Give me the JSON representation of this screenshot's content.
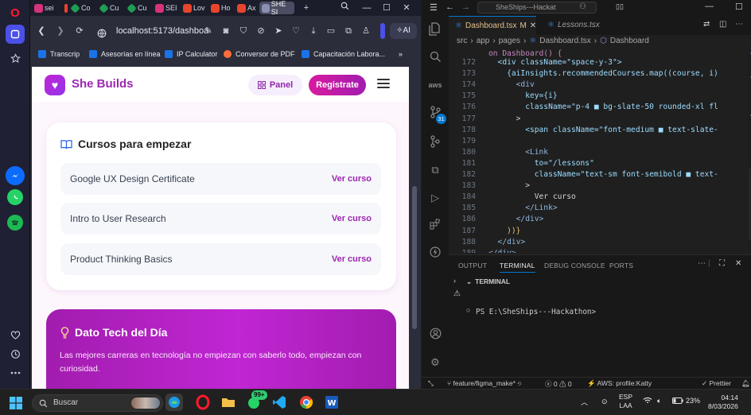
{
  "opera_sidebar": {
    "icons": [
      "opera-logo-icon",
      "workspace-icon",
      "star-icon",
      "messenger-icon",
      "whatsapp-icon",
      "spotify-icon",
      "heart-icon",
      "history-icon",
      "more-icon"
    ]
  },
  "browser": {
    "tabs": [
      {
        "label": "sei",
        "color": "#d6337d"
      },
      {
        "label": "",
        "color": "#e8452c"
      },
      {
        "label": "Co",
        "color": "#1f9d55"
      },
      {
        "label": "Cu",
        "color": "#1f9d55"
      },
      {
        "label": "Cu",
        "color": "#1f9d55"
      },
      {
        "label": "SEI",
        "color": "#d6337d"
      },
      {
        "label": "Lov",
        "color": "#e8452c"
      },
      {
        "label": "Ho",
        "color": "#e8452c"
      },
      {
        "label": "Ax",
        "color": "#e8452c"
      },
      {
        "label": "SHE SI",
        "color": "#8b8fb0"
      }
    ],
    "new_tab": "+",
    "url": "localhost:5173/dashboa",
    "ai_label": "AI",
    "bookmarks": [
      {
        "label": "Transcrip",
        "color": "#1a73e8"
      },
      {
        "label": "Asesorías en línea",
        "color": "#1a73e8"
      },
      {
        "label": "IP Calculator",
        "color": "#1a73e8"
      },
      {
        "label": "Conversor de PDF",
        "color": "#ff6d3a"
      },
      {
        "label": "Capacitación Labora...",
        "color": "#1a73e8"
      }
    ],
    "bookmarks_more": "»"
  },
  "page": {
    "brand": "She Builds",
    "panel_label": "Panel",
    "register_label": "Registrate",
    "courses": {
      "title": "Cursos para empezar",
      "items": [
        {
          "name": "Google UX Design Certificate",
          "link": "Ver curso"
        },
        {
          "name": "Intro to User Research",
          "link": "Ver curso"
        },
        {
          "name": "Product Thinking Basics",
          "link": "Ver curso"
        }
      ]
    },
    "tip": {
      "title": "Dato Tech del Día",
      "text": "Las mejores carreras en tecnología no empiezan con saberlo todo, empiezan con curiosidad."
    }
  },
  "vscode": {
    "title": "SheShips---Hackat",
    "tabs": [
      {
        "label": "Dashboard.tsx",
        "badge": "M",
        "active": true
      },
      {
        "label": "Lessons.tsx",
        "badge": "",
        "active": false
      }
    ],
    "breadcrumb": [
      "src",
      "app",
      "pages",
      "Dashboard.tsx",
      "Dashboard"
    ],
    "lines": [
      {
        "n": "172",
        "code": "  <div className=\"space-y-3\">"
      },
      {
        "n": "173",
        "code": "    {aiInsights.recommendedCourses.map((course, i)"
      },
      {
        "n": "174",
        "code": "      <div"
      },
      {
        "n": "175",
        "code": "        key={i}"
      },
      {
        "n": "176",
        "code": "        className=\"p-4 ■ bg-slate-50 rounded-xl fl"
      },
      {
        "n": "177",
        "code": "      >"
      },
      {
        "n": "178",
        "code": "        <span className=\"font-medium ■ text-slate-"
      },
      {
        "n": "179",
        "code": ""
      },
      {
        "n": "180",
        "code": "        <Link"
      },
      {
        "n": "181",
        "code": "          to=\"/lessons\""
      },
      {
        "n": "182",
        "code": "          className=\"text-sm font-semibold ■ text-"
      },
      {
        "n": "183",
        "code": "        >"
      },
      {
        "n": "184",
        "code": "          Ver curso"
      },
      {
        "n": "185",
        "code": "        </Link>"
      },
      {
        "n": "186",
        "code": "      </div>"
      },
      {
        "n": "187",
        "code": "    ))}"
      },
      {
        "n": "188",
        "code": "  </div>"
      },
      {
        "n": "189",
        "code": "</div>"
      }
    ],
    "first_line_fragment": "on Dashboard() {",
    "panel_tabs": [
      "OUTPUT",
      "TERMINAL",
      "DEBUG CONSOLE",
      "PORTS"
    ],
    "terminal_header": "TERMINAL",
    "terminal_prompt": "PS E:\\SheShips---Hackathon>",
    "status": {
      "branch": "feature/figma_make*",
      "errors": "0",
      "warnings": "0",
      "aws": "AWS: profile:Katty",
      "prettier": "Prettier"
    }
  },
  "taskbar": {
    "search_placeholder": "Buscar",
    "badge": "99+",
    "lang_top": "ESP",
    "lang_bottom": "LAA",
    "battery": "23%",
    "time": "04:14",
    "date": "8/03/2026"
  }
}
